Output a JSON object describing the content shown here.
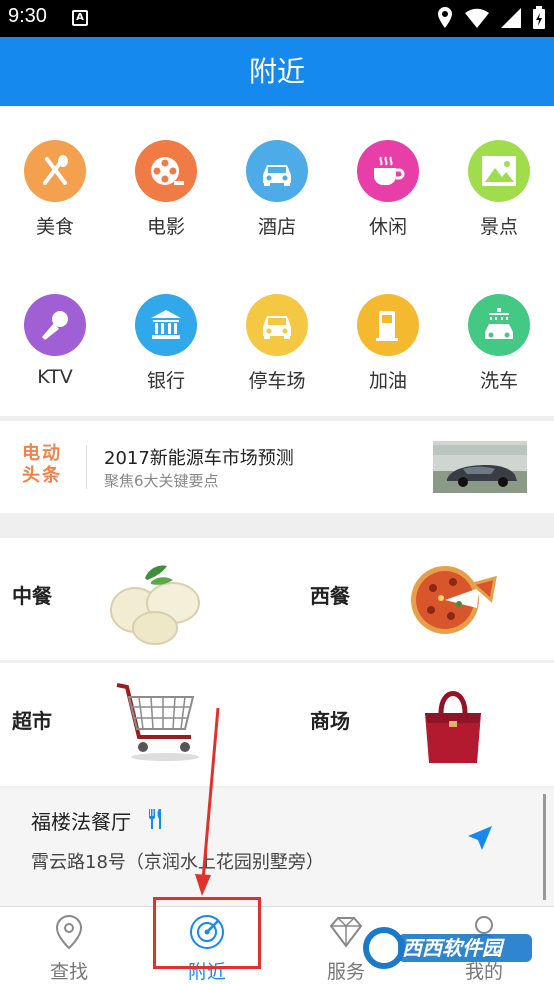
{
  "status_bar": {
    "time": "9:30",
    "notification_letter": "A"
  },
  "app_bar": {
    "title": "附近"
  },
  "categories": [
    {
      "label": "美食",
      "icon": "food-icon",
      "color": "#f3a04f"
    },
    {
      "label": "电影",
      "icon": "film-reel-icon",
      "color": "#f07b44"
    },
    {
      "label": "酒店",
      "icon": "car-icon",
      "color": "#4dace8"
    },
    {
      "label": "休闲",
      "icon": "coffee-cup-icon",
      "color": "#e83ea8"
    },
    {
      "label": "景点",
      "icon": "mountain-icon",
      "color": "#9fdd4d"
    },
    {
      "label": "KTV",
      "icon": "microphone-icon",
      "color": "#a15fd6"
    },
    {
      "label": "银行",
      "icon": "bank-icon",
      "color": "#31a8ea"
    },
    {
      "label": "停车场",
      "icon": "parking-car-icon",
      "color": "#f4c843"
    },
    {
      "label": "加油",
      "icon": "fuel-pump-icon",
      "color": "#f5b92f"
    },
    {
      "label": "洗车",
      "icon": "car-wash-icon",
      "color": "#43c983"
    }
  ],
  "banner": {
    "brand_line1": "电动",
    "brand_line2": "头条",
    "title": "2017新能源车市场预测",
    "subtitle": "聚焦6大关键要点"
  },
  "cards": [
    {
      "label": "中餐",
      "image": "dumplings-image"
    },
    {
      "label": "西餐",
      "image": "pizza-image"
    },
    {
      "label": "超市",
      "image": "shopping-cart-image"
    },
    {
      "label": "商场",
      "image": "handbag-image"
    }
  ],
  "place": {
    "name": "福楼法餐厅",
    "address": "霄云路18号（京润水上花园别墅旁）"
  },
  "tabs": [
    {
      "label": "查找",
      "icon": "location-pin-icon"
    },
    {
      "label": "附近",
      "icon": "radar-icon",
      "active": true
    },
    {
      "label": "服务",
      "icon": "diamond-icon"
    },
    {
      "label": "我的",
      "icon": "user-icon"
    }
  ],
  "watermark": {
    "text": "西西软件园"
  },
  "colors": {
    "primary": "#1589ee",
    "annotation": "#e0322b"
  }
}
